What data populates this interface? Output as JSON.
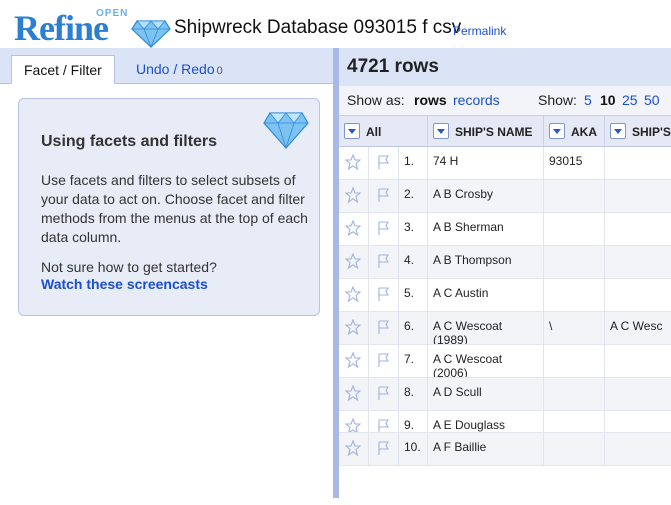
{
  "app": {
    "logo_small": "OPEN",
    "logo_main": "Refine",
    "project_title": "Shipwreck Database 093015 f csv",
    "permalink_label": "Permalink"
  },
  "left_panel": {
    "tabs": [
      {
        "label": "Facet / Filter"
      },
      {
        "label": "Undo / Redo",
        "count": "0"
      }
    ],
    "help": {
      "title": "Using facets and filters",
      "body": "Use facets and filters to select subsets of your data to act on. Choose facet and filter methods from the menus at the top of each data column.",
      "question": "Not sure how to get started?",
      "link": "Watch these screencasts"
    }
  },
  "right_panel": {
    "row_count": "4721 rows",
    "show_as_label": "Show as:",
    "modes": [
      "rows",
      "records"
    ],
    "show_label": "Show:",
    "page_sizes": [
      "5",
      "10",
      "25",
      "50"
    ],
    "columns": [
      "All",
      "SHIP'S NAME",
      "AKA",
      "SHIP'S"
    ],
    "rows": [
      {
        "num": "1.",
        "name": "74 H",
        "aka": "93015",
        "ships": ""
      },
      {
        "num": "2.",
        "name": "A B Crosby",
        "aka": "",
        "ships": ""
      },
      {
        "num": "3.",
        "name": "A B Sherman",
        "aka": "",
        "ships": ""
      },
      {
        "num": "4.",
        "name": "A B Thompson",
        "aka": "",
        "ships": ""
      },
      {
        "num": "5.",
        "name": "A C Austin",
        "aka": "",
        "ships": ""
      },
      {
        "num": "6.",
        "name": "A C Wescoat (1989)",
        "aka": "\\",
        "ships": "A C Wesc"
      },
      {
        "num": "7.",
        "name": "A C Wescoat (2006)",
        "aka": "",
        "ships": ""
      },
      {
        "num": "8.",
        "name": "A D Scull",
        "aka": "",
        "ships": ""
      },
      {
        "num": "9.",
        "name": "A E Douglass",
        "aka": "",
        "ships": ""
      },
      {
        "num": "10.",
        "name": "A F Baillie",
        "aka": "",
        "ships": ""
      }
    ]
  },
  "colors": {
    "accent_blue": "#1a4fd0",
    "panel_blue": "#dbe3f6",
    "divider_blue": "#a9b9e6"
  },
  "icons": {
    "logo": "diamond-icon",
    "row_star": "star-icon",
    "row_flag": "flag-icon",
    "column_menu": "chevron-down-icon"
  }
}
